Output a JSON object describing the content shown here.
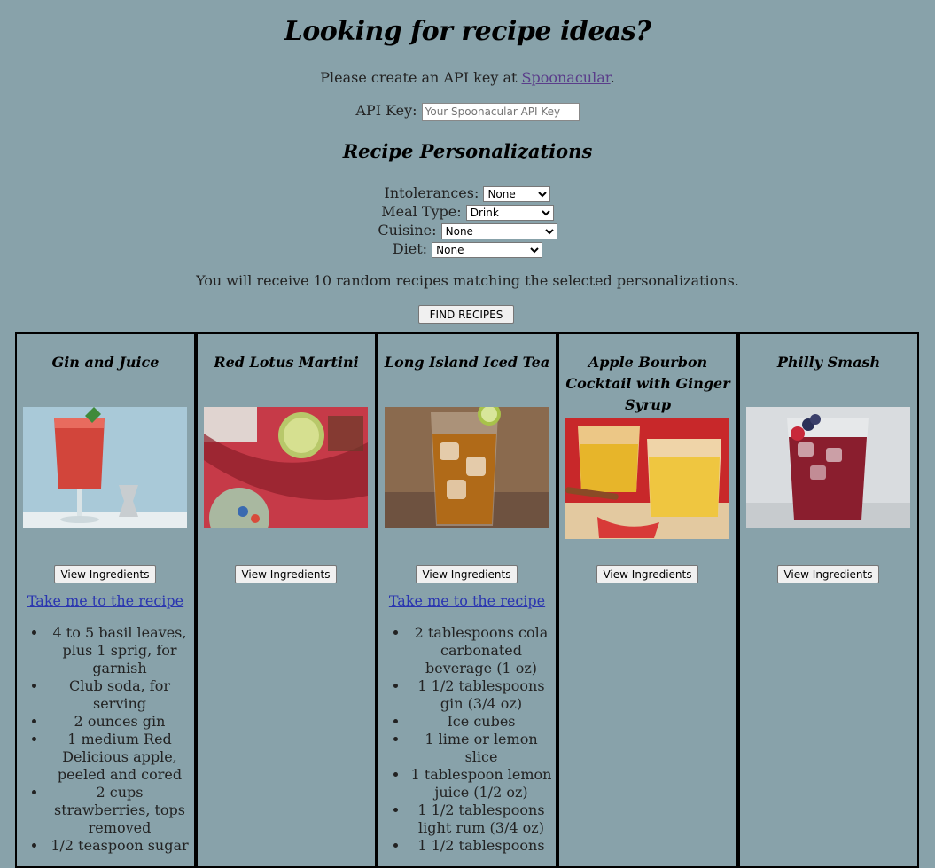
{
  "header": {
    "title": "Looking for recipe ideas?",
    "api_note_prefix": "Please create an API key at ",
    "api_link": "Spoonacular",
    "api_note_suffix": ".",
    "api_label": "API Key:",
    "api_placeholder": "Your Spoonacular API Key"
  },
  "personalizations": {
    "heading": "Recipe Personalizations",
    "intolerances": {
      "label": "Intolerances:",
      "value": "None"
    },
    "meal_type": {
      "label": "Meal Type:",
      "value": "Drink"
    },
    "cuisine": {
      "label": "Cuisine:",
      "value": "None"
    },
    "diet": {
      "label": "Diet:",
      "value": "None"
    },
    "info": "You will receive 10 random recipes matching the selected personalizations.",
    "find_button": "FIND RECIPES"
  },
  "recipes": [
    {
      "title": "Gin and Juice",
      "view_label": "View Ingredients",
      "link_label": "Take me to the recipe",
      "ingredients": [
        "4 to 5 basil leaves, plus 1 sprig, for garnish",
        "Club soda, for serving",
        "2 ounces gin",
        "1 medium Red Delicious apple, peeled and cored",
        "2 cups strawberries, tops removed",
        "1/2 teaspoon sugar"
      ]
    },
    {
      "title": "Red Lotus Martini",
      "view_label": "View Ingredients"
    },
    {
      "title": "Long Island Iced Tea",
      "view_label": "View Ingredients",
      "link_label": "Take me to the recipe",
      "ingredients": [
        "2 tablespoons cola carbonated beverage (1 oz)",
        "1 1/2 tablespoons gin (3/4 oz)",
        "Ice cubes",
        "1 lime or lemon slice",
        "1 tablespoon lemon juice (1/2 oz)",
        "1 1/2 tablespoons light rum (3/4 oz)",
        "1 1/2 tablespoons"
      ]
    },
    {
      "title": "Apple Bourbon Cocktail with Ginger Syrup",
      "view_label": "View Ingredients"
    },
    {
      "title": "Philly Smash",
      "view_label": "View Ingredients"
    }
  ]
}
